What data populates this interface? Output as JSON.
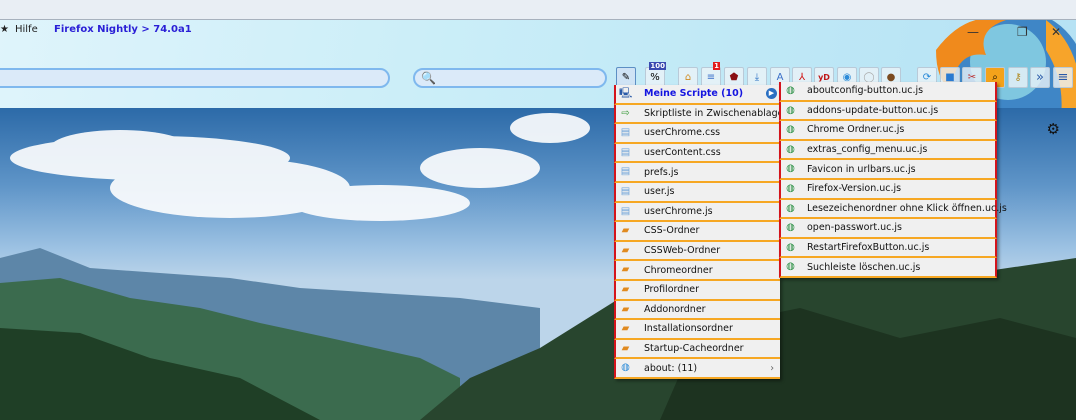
{
  "menubar": {
    "star": "★",
    "help": "Hilfe",
    "title": "Firefox Nightly > 74.0a1"
  },
  "window": {
    "minimize": "—",
    "restore": "❐",
    "close": "✕"
  },
  "search": {
    "icon": "🔍"
  },
  "toolbar": {
    "badge_100": "100",
    "badge_1": "1",
    "yd": "yD",
    "overflow": "»",
    "menu": "≡"
  },
  "left_menu": {
    "items": [
      {
        "label": "Meine Scripte (10)",
        "icon": "computer-icon"
      },
      {
        "label": "Skriptliste in Zwischenablage",
        "icon": "export-icon"
      },
      {
        "label": "userChrome.css",
        "icon": "file-icon"
      },
      {
        "label": "userContent.css",
        "icon": "file-icon"
      },
      {
        "label": "prefs.js",
        "icon": "file-icon"
      },
      {
        "label": "user.js",
        "icon": "file-icon"
      },
      {
        "label": "userChrome.js",
        "icon": "file-icon"
      },
      {
        "label": "CSS-Ordner",
        "icon": "folder-icon"
      },
      {
        "label": "CSSWeb-Ordner",
        "icon": "folder-icon"
      },
      {
        "label": "Chromeordner",
        "icon": "folder-icon"
      },
      {
        "label": "Profilordner",
        "icon": "folder-icon"
      },
      {
        "label": "Addonordner",
        "icon": "folder-icon"
      },
      {
        "label": "Installationsordner",
        "icon": "folder-icon"
      },
      {
        "label": "Startup-Cacheordner",
        "icon": "folder-icon"
      },
      {
        "label": "about: (11)",
        "icon": "globe-icon",
        "arrow": "›"
      }
    ]
  },
  "right_menu": {
    "items": [
      "aboutconfig-button.uc.js",
      "addons-update-button.uc.js",
      "Chrome Ordner.uc.js",
      "extras_config_menu.uc.js",
      "Favicon in urlbars.uc.js",
      "Firefox-Version.uc.js",
      "Lesezeichenordner ohne Klick öffnen.uc.js",
      "open-passwort.uc.js",
      "RestartFirefoxButton.uc.js",
      "Suchleiste löschen.uc.js"
    ]
  },
  "colors": {
    "accent_red": "#d4141c",
    "accent_orange": "#f6a723",
    "title_blue": "#2a1fd6"
  }
}
